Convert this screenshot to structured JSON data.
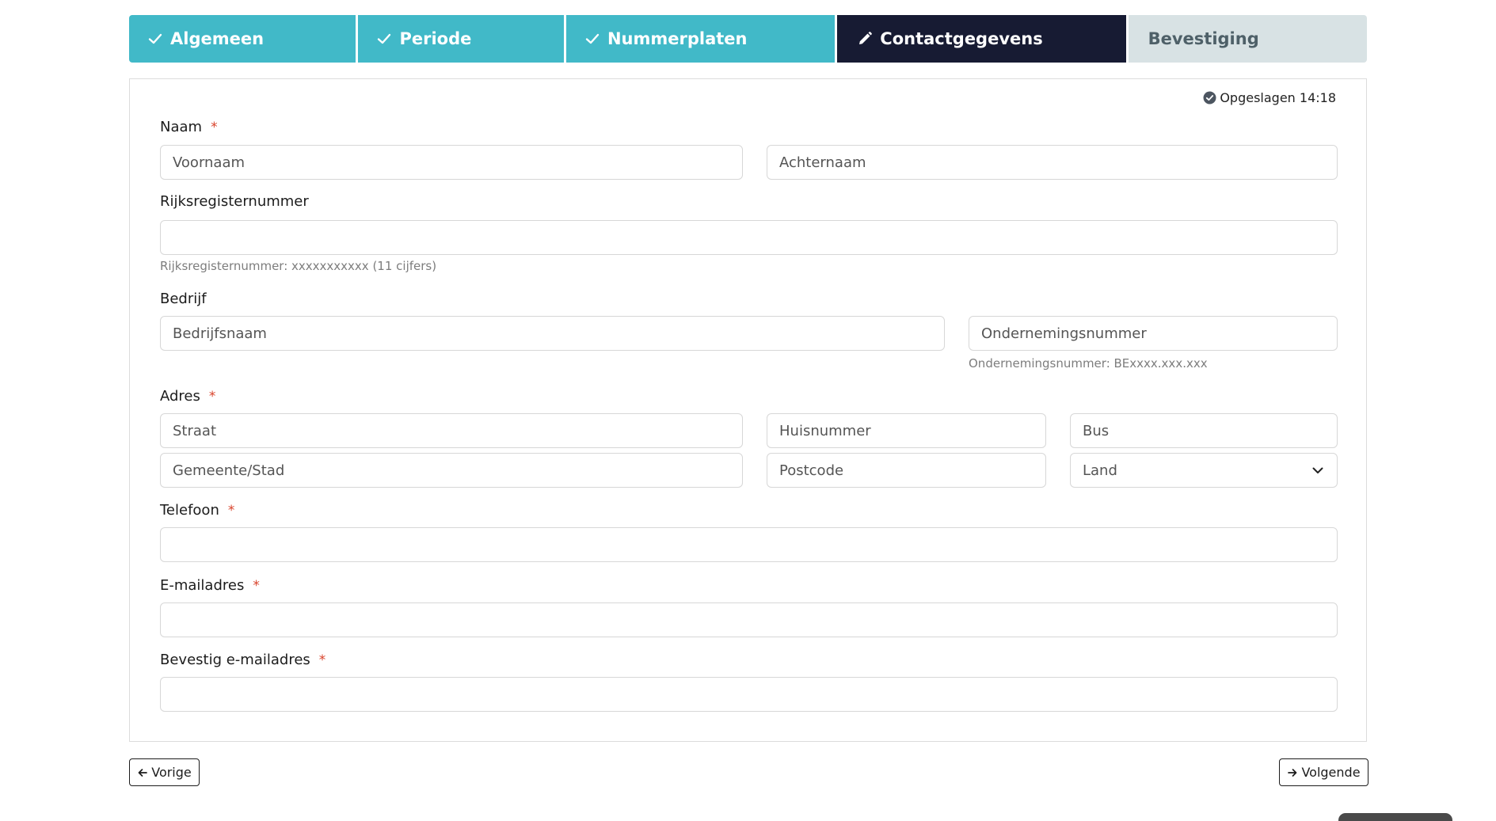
{
  "stepper": {
    "steps": [
      {
        "label": "Algemeen",
        "state": "done"
      },
      {
        "label": "Periode",
        "state": "done"
      },
      {
        "label": "Nummerplaten",
        "state": "done"
      },
      {
        "label": "Contactgegevens",
        "state": "active"
      },
      {
        "label": "Bevestiging",
        "state": "todo"
      }
    ]
  },
  "form": {
    "saved_status": "Opgeslagen 14:18",
    "required_mark": "*",
    "naam": {
      "label": "Naam",
      "voornaam_placeholder": "Voornaam",
      "achternaam_placeholder": "Achternaam"
    },
    "rijksregister": {
      "label": "Rijksregisternummer",
      "value": "",
      "hint": "Rijksregisternummer: xxxxxxxxxxx (11 cijfers)"
    },
    "bedrijf": {
      "label": "Bedrijf",
      "bedrijfsnaam_placeholder": "Bedrijfsnaam",
      "ondernemingsnummer_placeholder": "Ondernemingsnummer",
      "hint": "Ondernemingsnummer: BExxxx.xxx.xxx"
    },
    "adres": {
      "label": "Adres",
      "straat_placeholder": "Straat",
      "huisnummer_placeholder": "Huisnummer",
      "bus_placeholder": "Bus",
      "gemeente_placeholder": "Gemeente/Stad",
      "postcode_placeholder": "Postcode",
      "land_selected": "Land"
    },
    "telefoon": {
      "label": "Telefoon",
      "value": ""
    },
    "email": {
      "label": "E-mailadres",
      "value": ""
    },
    "email_confirm": {
      "label": "Bevestig e-mailadres",
      "value": ""
    }
  },
  "nav": {
    "prev_label": "Vorige",
    "next_label": "Volgende"
  },
  "colors": {
    "step_done": "#41b9c8",
    "step_active": "#171b33",
    "step_todo": "#d8e2e4",
    "required": "#d9432b"
  },
  "icons": {
    "done_step": "check-icon",
    "active_step": "pencil-icon",
    "saved": "check-circle-icon",
    "select": "chevron-down-icon",
    "prev": "arrow-left-icon",
    "next": "arrow-right-icon"
  }
}
